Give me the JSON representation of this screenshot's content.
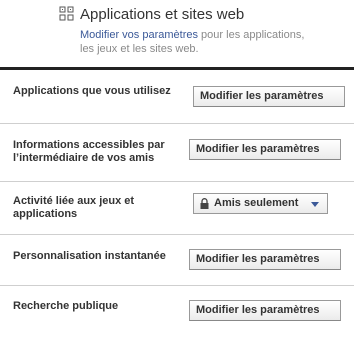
{
  "header": {
    "title": "Applications et sites web",
    "description_link": "Modifier vos paramètres",
    "description_rest": " pour les applications, les jeux et les sites web.",
    "icon": "applications-icon"
  },
  "rows": [
    {
      "label": "Applications que vous utilisez",
      "control": "button",
      "button_label": "Modifier les paramètres"
    },
    {
      "label": "Informations accessibles par l’intermédiaire de vos amis",
      "control": "button",
      "button_label": "Modifier les paramètres"
    },
    {
      "label": "Activité liée aux jeux et applications",
      "control": "dropdown",
      "selected": "Amis seulement",
      "icon": "lock-icon"
    },
    {
      "label": "Personnalisation instantanée",
      "control": "button",
      "button_label": "Modifier les paramètres"
    },
    {
      "label": "Recherche publique",
      "control": "button",
      "button_label": "Modifier les paramètres"
    }
  ],
  "colors": {
    "link": "#3b5998",
    "rule": "#222222",
    "separator": "#cfcfcf"
  }
}
